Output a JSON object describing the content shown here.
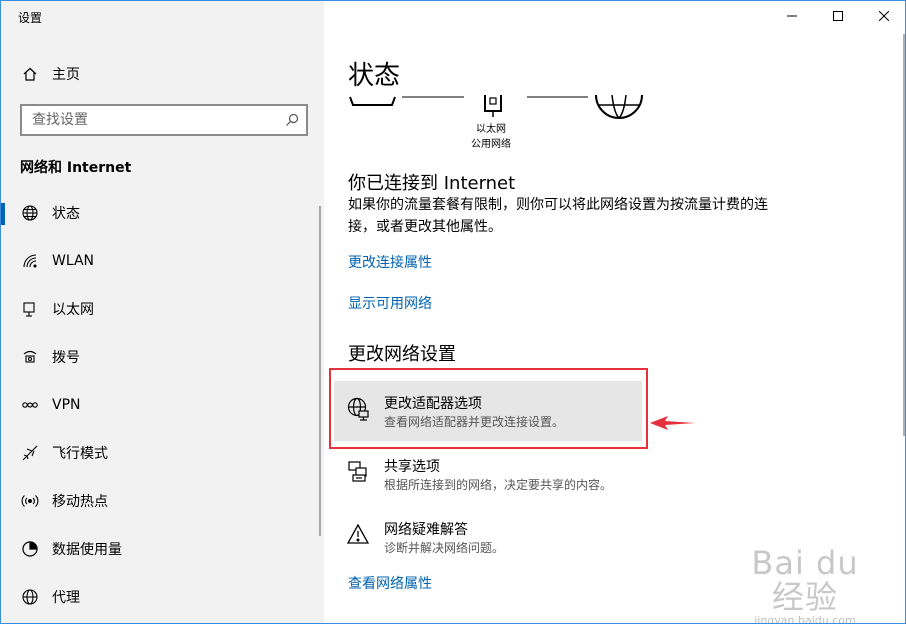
{
  "app": {
    "title": "设置"
  },
  "sidebar": {
    "home": "主页",
    "search_placeholder": "查找设置",
    "section": "网络和 Internet",
    "items": [
      {
        "label": "状态",
        "icon": "globe-icon",
        "active": true
      },
      {
        "label": "WLAN",
        "icon": "wifi-icon"
      },
      {
        "label": "以太网",
        "icon": "ethernet-icon"
      },
      {
        "label": "拨号",
        "icon": "dialup-icon"
      },
      {
        "label": "VPN",
        "icon": "vpn-icon"
      },
      {
        "label": "飞行模式",
        "icon": "airplane-icon"
      },
      {
        "label": "移动热点",
        "icon": "hotspot-icon"
      },
      {
        "label": "数据使用量",
        "icon": "data-usage-icon"
      },
      {
        "label": "代理",
        "icon": "proxy-globe-icon"
      }
    ]
  },
  "main": {
    "title": "状态",
    "network": {
      "adapter": "以太网",
      "profile": "公用网络"
    },
    "connected_heading": "你已连接到 Internet",
    "connected_desc": "如果你的流量套餐有限制，则你可以将此网络设置为按流量计费的连接，或者更改其他属性。",
    "link_change_props": "更改连接属性",
    "link_show_networks": "显示可用网络",
    "change_heading": "更改网络设置",
    "options": [
      {
        "title": "更改适配器选项",
        "desc": "查看网络适配器并更改连接设置。",
        "icon": "adapter-globe-icon"
      },
      {
        "title": "共享选项",
        "desc": "根据所连接到的网络，决定要共享的内容。",
        "icon": "sharing-icon"
      },
      {
        "title": "网络疑难解答",
        "desc": "诊断并解决网络问题。",
        "icon": "warning-icon"
      }
    ],
    "link_view_props": "查看网络属性"
  },
  "watermark": {
    "brand": "Bai du 经验",
    "url": "jingyan.baidu.com"
  },
  "colors": {
    "accent": "#0063b1",
    "highlight_border": "#e4313b",
    "sidebar_bg": "#f2f2f2",
    "selected_option_bg": "#e6e6e6"
  }
}
